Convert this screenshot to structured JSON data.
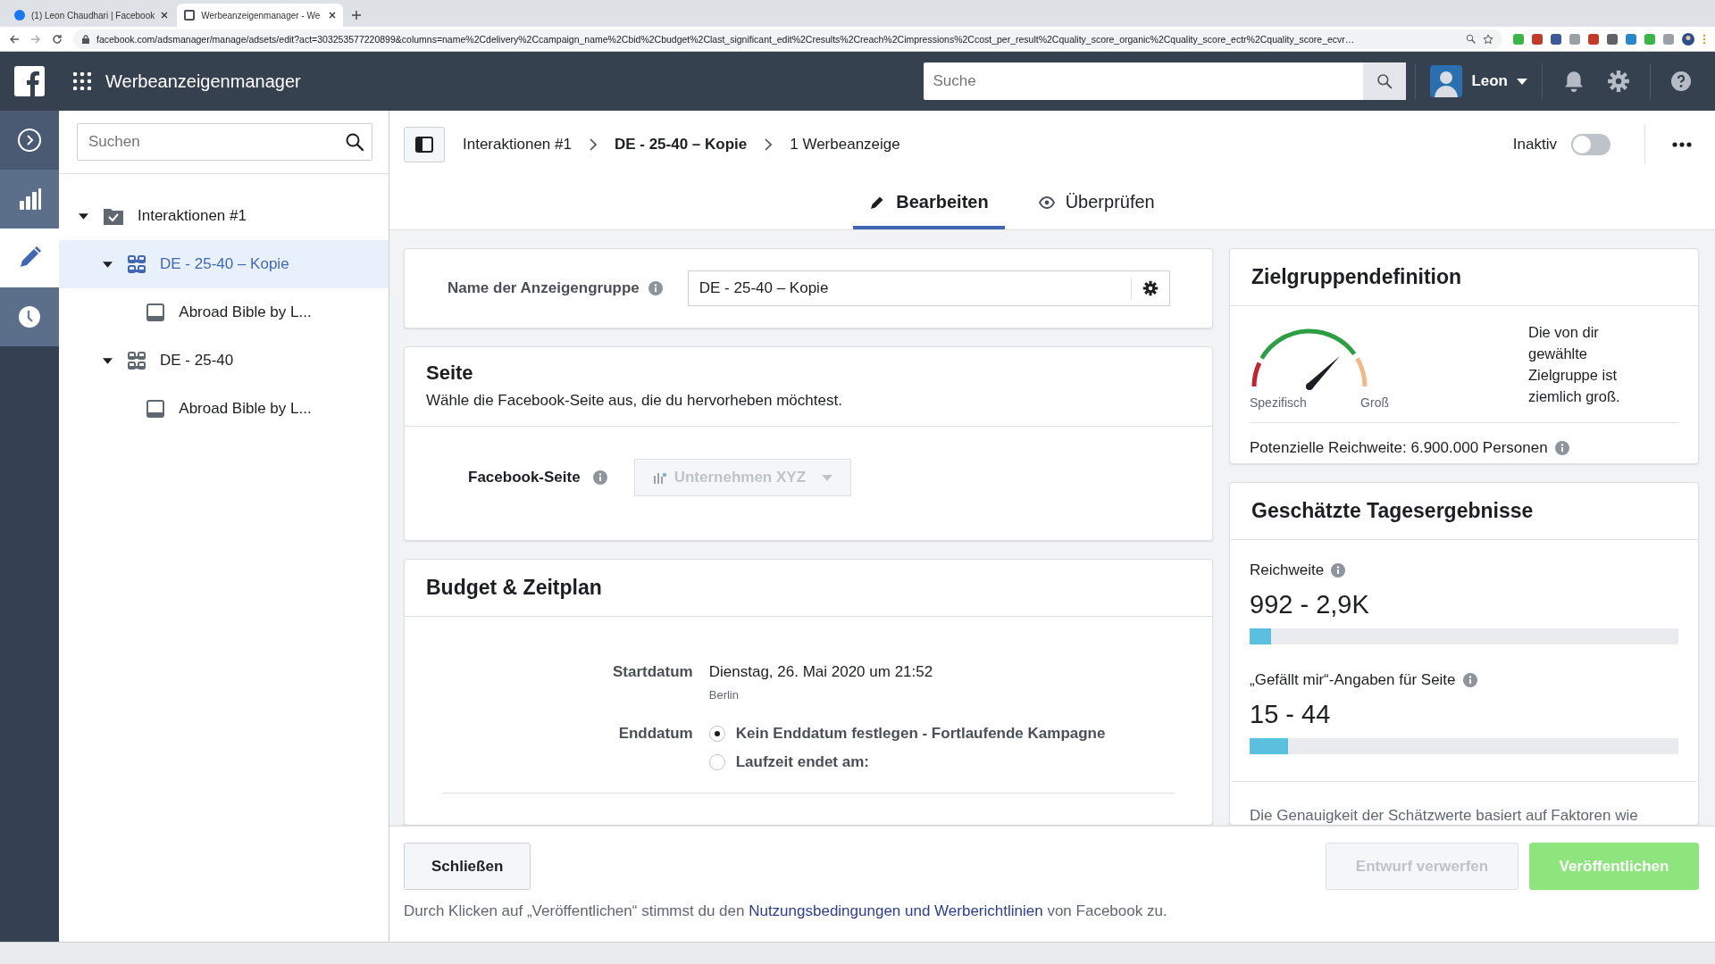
{
  "browser": {
    "tabs": [
      {
        "title": "(1) Leon Chaudhari | Facebook",
        "selected": false
      },
      {
        "title": "Werbeanzeigenmanager - We",
        "selected": true
      }
    ],
    "url": "facebook.com/adsmanager/manage/adsets/edit?act=303253577220899&columns=name%2Cdelivery%2Ccampaign_name%2Cbid%2Cbudget%2Clast_significant_edit%2Cresults%2Creach%2Cimpressions%2Ccost_per_result%2Cquality_score_organic%2Cquality_score_ectr%2Cquality_score_ecvr…"
  },
  "header": {
    "app_title": "Werbeanzeigenmanager",
    "search": {
      "placeholder": "Suche"
    },
    "user": "Leon"
  },
  "rail": [
    {
      "kind": "toggle",
      "selected": false
    },
    {
      "kind": "reports",
      "selected": false
    },
    {
      "kind": "edit",
      "selected": true
    },
    {
      "kind": "history",
      "selected": false
    }
  ],
  "tree": {
    "search": {
      "placeholder": "Suchen"
    },
    "items": [
      {
        "kind": "campaign",
        "label": "Interaktionen #1",
        "expanded": true,
        "selected": false,
        "children": [
          {
            "kind": "adset",
            "label": "DE - 25-40 – Kopie",
            "expanded": true,
            "selected": true,
            "children": [
              {
                "kind": "ad",
                "label": "Abroad Bible by L...",
                "selected": false
              }
            ]
          },
          {
            "kind": "adset",
            "label": "DE - 25-40",
            "expanded": true,
            "selected": false,
            "children": [
              {
                "kind": "ad",
                "label": "Abroad Bible by L...",
                "selected": false
              }
            ]
          }
        ]
      }
    ]
  },
  "breadcrumb": [
    {
      "label": "Interaktionen #1",
      "current": false
    },
    {
      "label": "DE - 25-40 – Kopie",
      "current": true
    },
    {
      "label": "1 Werbeanzeige",
      "current": false
    }
  ],
  "status": {
    "label": "Inaktiv",
    "on": false
  },
  "tabs": [
    {
      "label": "Bearbeiten",
      "kind": "edit",
      "selected": true
    },
    {
      "label": "Überprüfen",
      "kind": "review",
      "selected": false
    }
  ],
  "name_card": {
    "label": "Name der Anzeigengruppe",
    "value": "DE - 25-40 – Kopie"
  },
  "page_card": {
    "title": "Seite",
    "description": "Wähle die Facebook-Seite aus, die du hervorheben möchtest.",
    "field_label": "Facebook-Seite",
    "dropdown": {
      "value": "Unternehmen XYZ",
      "disabled": true
    }
  },
  "budget_card": {
    "title": "Budget & Zeitplan",
    "start_label": "Startdatum",
    "start_value": "Dienstag, 26. Mai 2020 um 21:52",
    "timezone": "Berlin",
    "end_label": "Enddatum",
    "end_options": [
      {
        "label": "Kein Enddatum festlegen - Fortlaufende Kampagne",
        "selected": true
      },
      {
        "label": "Laufzeit endet am:",
        "selected": false
      }
    ]
  },
  "audience": {
    "title": "Zielgruppendefinition",
    "gauge": {
      "min_label": "Spezifisch",
      "max_label": "Groß",
      "level": 0.75
    },
    "summary": "Die von dir gewählte Zielgruppe ist ziemlich groß.",
    "reach": "Potenzielle Reichweite: 6.900.000 Personen"
  },
  "estimates": {
    "title": "Geschätzte Tagesergebnisse",
    "metrics": [
      {
        "label": "Reichweite",
        "value": "992 - 2,9K",
        "level": 0.05
      },
      {
        "label": "„Gefällt mir“-Angaben für Seite",
        "value": "15 - 44",
        "level": 0.09
      }
    ],
    "note": "Die Genauigkeit der Schätzwerte basiert auf Faktoren wie"
  },
  "footer": {
    "close": "Schließen",
    "discard": {
      "label": "Entwurf verwerfen",
      "disabled": true
    },
    "publish": {
      "label": "Veröffentlichen",
      "disabled": true
    },
    "legal": {
      "before": "Durch Klicken auf „Veröffentlichen“ stimmst du den ",
      "link": "Nutzungsbedingungen und Werberichtlinien",
      "after": " von Facebook zu."
    }
  }
}
